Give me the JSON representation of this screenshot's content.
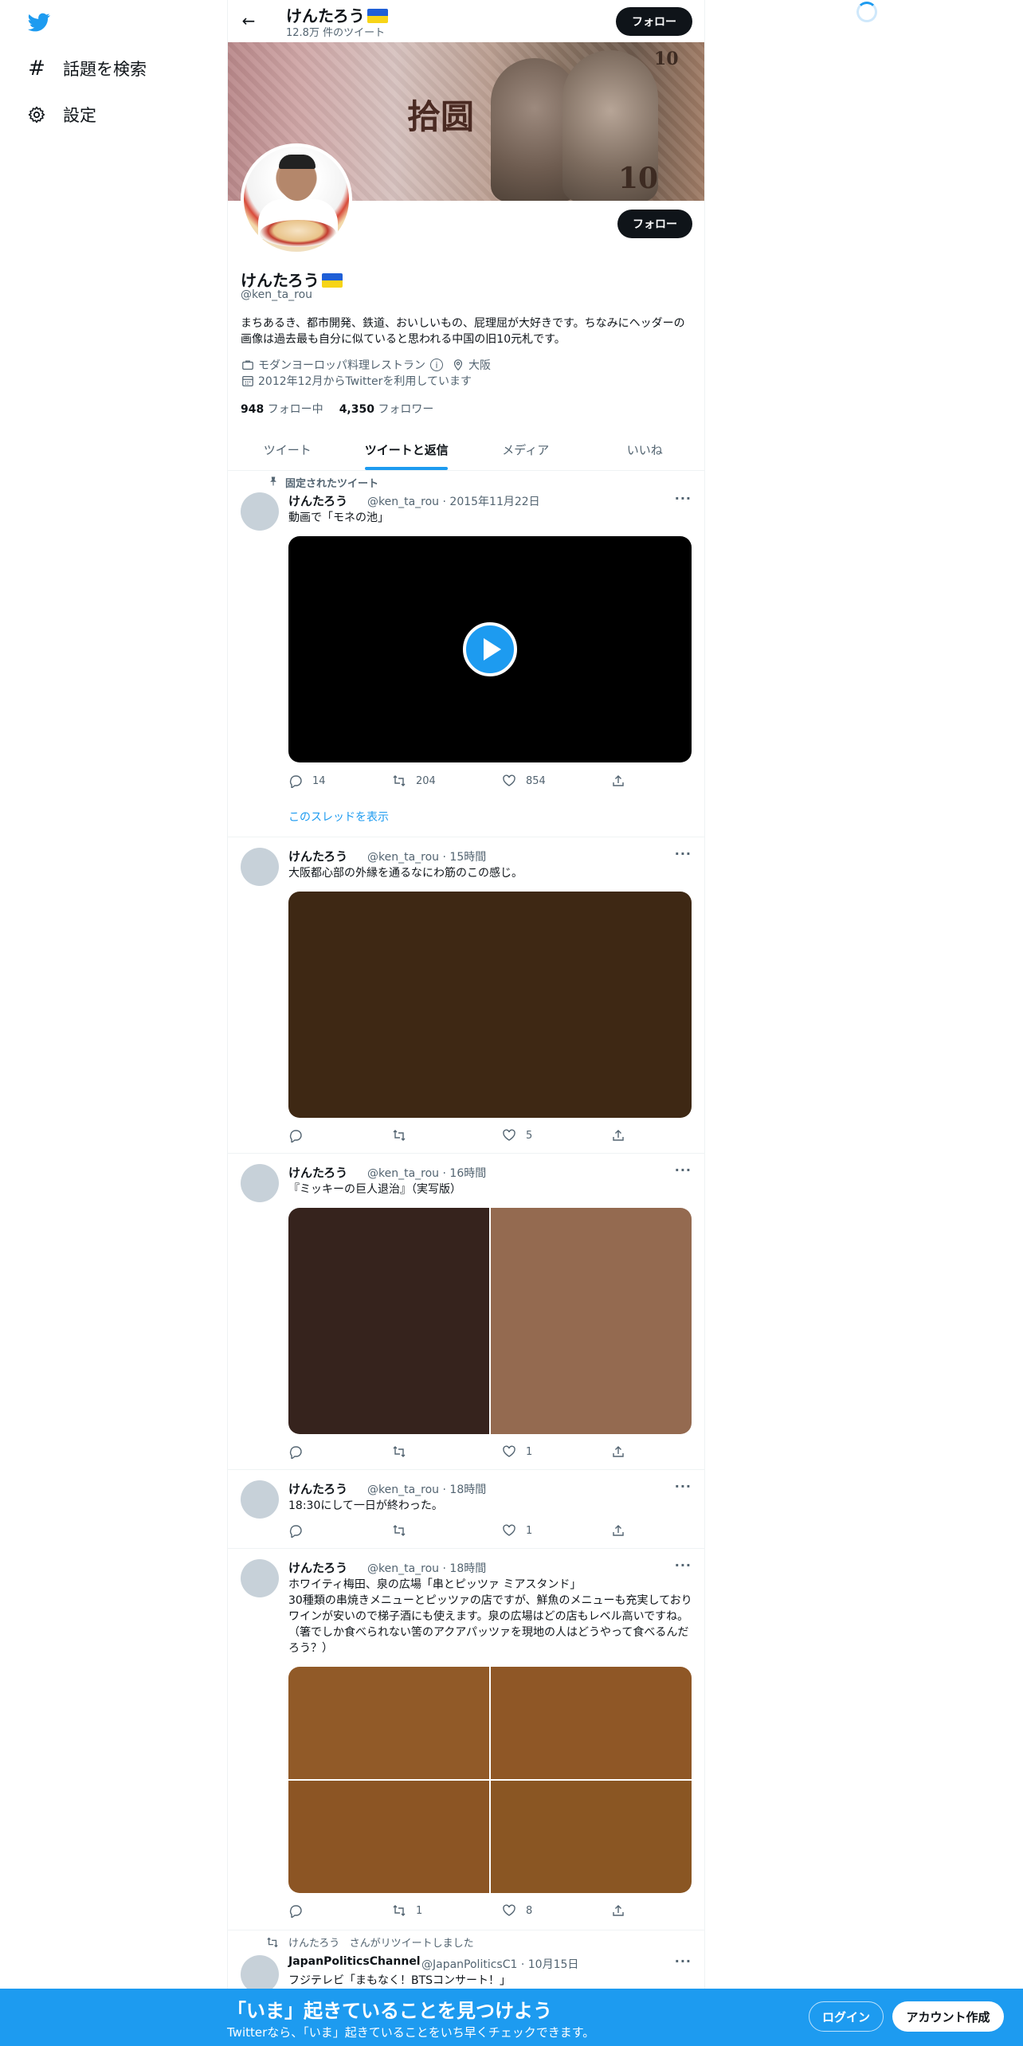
{
  "nav": {
    "logo": "twitter-bird-icon",
    "items": [
      {
        "icon": "hashtag-icon",
        "label": "話題を検索"
      },
      {
        "icon": "gear-icon",
        "label": "設定"
      }
    ]
  },
  "topbar": {
    "name": "けんたろう",
    "tweet_count": "12.8万 件のツイート",
    "follow_label": "フォロー"
  },
  "header_image": {
    "hanzi": "拾圆",
    "denomination": "10"
  },
  "profile": {
    "name": "けんたろう",
    "handle": "@ken_ta_rou",
    "bio": "まちあるき、都市開発、鉄道、おいしいもの、屁理屈が大好きです。ちなみにヘッダーの画像は過去最も自分に似ていると思われる中国の旧10元札です。",
    "category": "モダンヨーロッパ料理レストラン",
    "location": "大阪",
    "joined": "2012年12月からTwitterを利用しています",
    "following_count": "948",
    "following_label": "フォロー中",
    "followers_count": "4,350",
    "followers_label": "フォロワー",
    "follow_label": "フォロー",
    "flag_colors": [
      "#1f5fd6",
      "#f7d417"
    ]
  },
  "tabs": [
    {
      "label": "ツイート",
      "active": false
    },
    {
      "label": "ツイートと返信",
      "active": true
    },
    {
      "label": "メディア",
      "active": false
    },
    {
      "label": "いいね",
      "active": false
    }
  ],
  "tweets": {
    "pinned_label": "固定されたツイート",
    "t1": {
      "name": "けんたろう",
      "handle": "@ken_ta_rou",
      "time": "2015年11月22日",
      "text": "動画で「モネの池」",
      "reply": "14",
      "retweet": "204",
      "like": "854",
      "show_thread": "このスレッドを表示"
    },
    "t2": {
      "name": "けんたろう",
      "handle": "@ken_ta_rou",
      "time": "15時間",
      "text": "大阪都心部の外縁を通るなにわ筋のこの感じ。",
      "reply": "",
      "retweet": "",
      "like": "5",
      "media_color": "#3e2814"
    },
    "t3": {
      "name": "けんたろう",
      "handle": "@ken_ta_rou",
      "time": "16時間",
      "text": "『ミッキーの巨人退治』（実写版）",
      "reply": "",
      "retweet": "",
      "like": "1",
      "media_colors": [
        "#36231d",
        "#946a50"
      ]
    },
    "t4": {
      "name": "けんたろう",
      "handle": "@ken_ta_rou",
      "time": "18時間",
      "text": "18:30にして一日が終わった。",
      "reply": "",
      "retweet": "",
      "like": "1"
    },
    "t5": {
      "name": "けんたろう",
      "handle": "@ken_ta_rou",
      "time": "18時間",
      "text": "ホワイティ梅田、泉の広場「串とピッツァ ミアスタンド」\n30種類の串焼きメニューとピッツァの店ですが、鮮魚のメニューも充実しておりワインが安いので梯子酒にも使えます。泉の広場はどの店もレベル高いですね。（箸でしか食べられない筈のアクアパッツァを現地の人はどうやって食べるんだろう？）",
      "reply": "",
      "retweet": "1",
      "like": "8",
      "media_colors": [
        "#915a28",
        "#8f5726",
        "#8c5524",
        "#8a5623"
      ]
    },
    "t6": {
      "retweet_note_name": "けんたろう",
      "retweet_note_suffix": "さんがリツイートしました",
      "name": "JapanPoliticsChannel",
      "handle": "@JapanPoliticsC1",
      "time": "10月15日",
      "text": "フジテレビ「まもなく！BTSコンサート！」"
    }
  },
  "bottombar": {
    "title": "「いま」起きていることを見つけよう",
    "subtitle": "Twitterなら、「いま」起きていることをいち早くチェックできます。",
    "login": "ログイン",
    "signup": "アカウント作成"
  },
  "colors": {
    "accent": "#1d9bf0",
    "text": "#0f1419",
    "secondary": "#536471"
  }
}
